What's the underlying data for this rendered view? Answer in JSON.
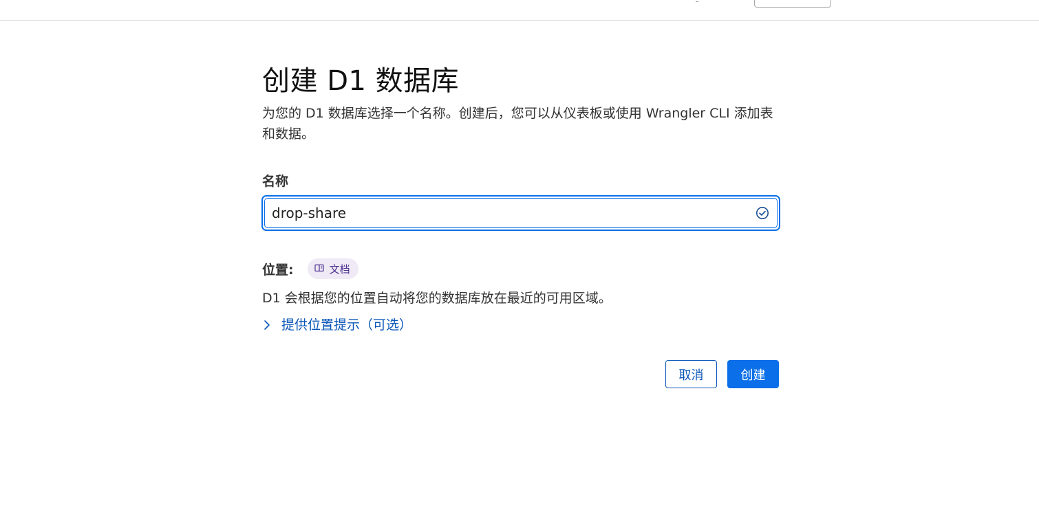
{
  "page": {
    "title": "创建 D1 数据库",
    "description": "为您的 D1 数据库选择一个名称。创建后，您可以从仪表板或使用 Wrangler CLI 添加表和数据。"
  },
  "name_field": {
    "label": "名称",
    "value": "drop-share",
    "status_icon": "check-circle-icon"
  },
  "location": {
    "label": "位置:",
    "docs_badge_label": "文档",
    "docs_icon": "book-icon",
    "description": "D1 会根据您的位置自动将您的数据库放在最近的可用区域。",
    "hint_toggle_label": "提供位置提示（可选）",
    "hint_icon": "chevron-right-icon"
  },
  "actions": {
    "cancel_label": "取消",
    "create_label": "创建"
  },
  "colors": {
    "accent": "#0a6fe8",
    "link": "#0a56b8",
    "badge_bg": "#efeaf6",
    "badge_text": "#4a2e8e"
  }
}
